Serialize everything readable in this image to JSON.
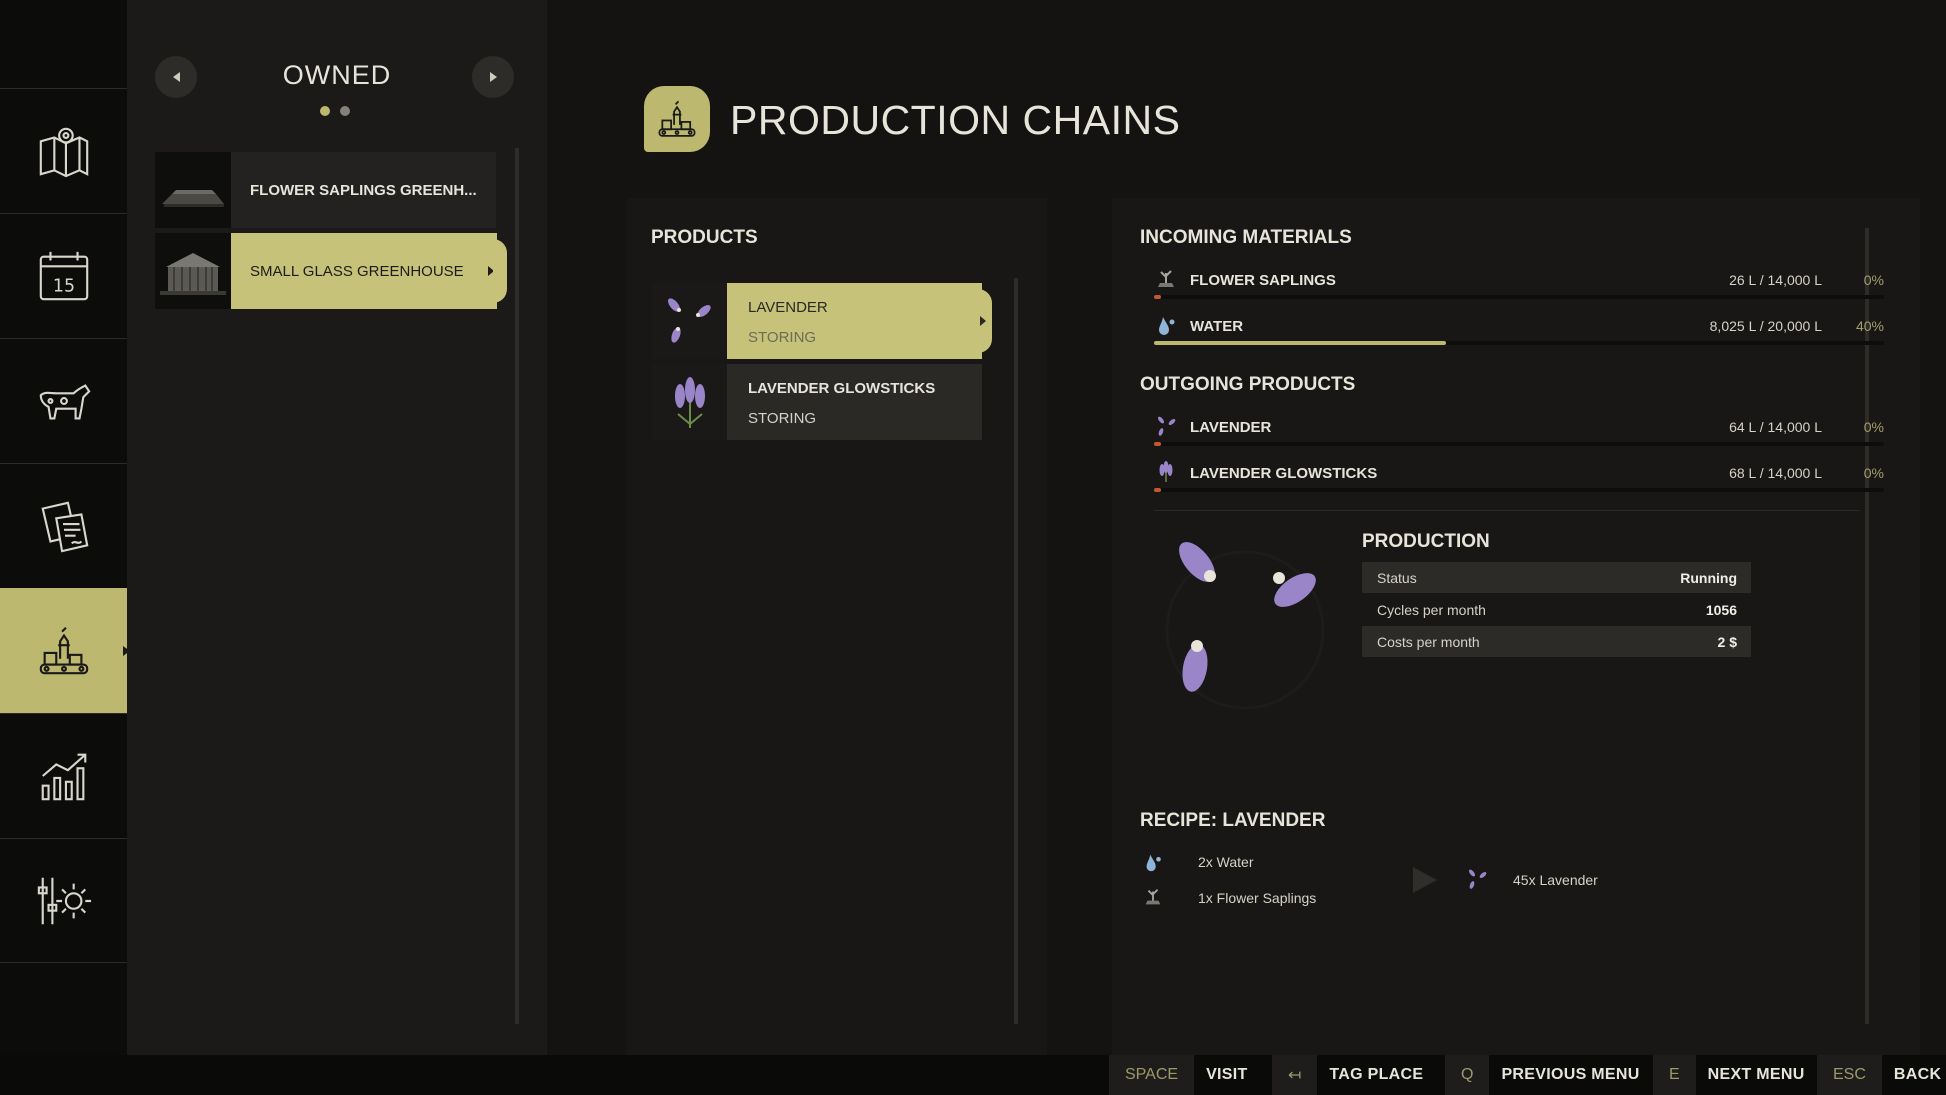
{
  "owned_panel": {
    "title": "OWNED",
    "items": [
      {
        "label": "FLOWER SAPLINGS GREENH..."
      },
      {
        "label": "SMALL GLASS GREENHOUSE"
      }
    ]
  },
  "page": {
    "title": "PRODUCTION CHAINS"
  },
  "products": {
    "heading": "PRODUCTS",
    "items": [
      {
        "name": "LAVENDER",
        "state": "STORING"
      },
      {
        "name": "LAVENDER GLOWSTICKS",
        "state": "STORING"
      }
    ]
  },
  "incoming": {
    "heading": "INCOMING MATERIALS",
    "items": [
      {
        "name": "FLOWER SAPLINGS",
        "amount": "26 L / 14,000 L",
        "percent": "0%",
        "fill": 0.0019,
        "color": "#c4582f"
      },
      {
        "name": "WATER",
        "amount": "8,025 L / 20,000 L",
        "percent": "40%",
        "fill": 0.4,
        "color": "#bdb86f"
      }
    ]
  },
  "outgoing": {
    "heading": "OUTGOING PRODUCTS",
    "items": [
      {
        "name": "LAVENDER",
        "amount": "64 L / 14,000 L",
        "percent": "0%",
        "fill": 0.0046,
        "color": "#c4582f"
      },
      {
        "name": "LAVENDER GLOWSTICKS",
        "amount": "68 L / 14,000 L",
        "percent": "0%",
        "fill": 0.0049,
        "color": "#c4582f"
      }
    ]
  },
  "production": {
    "heading": "PRODUCTION",
    "status_label": "Status",
    "status_value": "Running",
    "cycles_label": "Cycles per month",
    "cycles_value": "1056",
    "costs_label": "Costs per month",
    "costs_value": "2 $"
  },
  "recipe": {
    "heading": "RECIPE: LAVENDER",
    "inputs": [
      "2x Water",
      "1x Flower Saplings"
    ],
    "output": "45x Lavender"
  },
  "bottom_bar": {
    "hints": [
      {
        "key": "SPACE",
        "action": "VISIT"
      },
      {
        "key": "↤",
        "action": "TAG PLACE"
      },
      {
        "key": "Q",
        "action": "PREVIOUS MENU"
      },
      {
        "key": "E",
        "action": "NEXT MENU"
      },
      {
        "key": "ESC",
        "action": "BACK"
      }
    ]
  },
  "colors": {
    "accent": "#bdb86f",
    "low_fill": "#c4582f",
    "lavender": "#9a85c9"
  },
  "icons": {
    "rail": [
      "map-icon",
      "calendar-icon",
      "animals-icon",
      "contracts-icon",
      "production-icon",
      "statistics-icon",
      "settings-icon"
    ],
    "calendar_day": "15"
  }
}
